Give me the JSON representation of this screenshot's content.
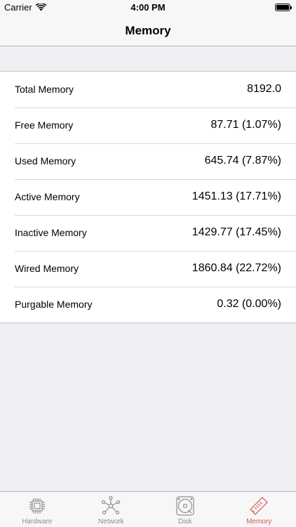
{
  "status_bar": {
    "carrier": "Carrier",
    "time": "4:00 PM"
  },
  "nav": {
    "title": "Memory"
  },
  "rows": [
    {
      "label": "Total Memory",
      "value": "8192.0"
    },
    {
      "label": "Free Memory",
      "value": "87.71 (1.07%)"
    },
    {
      "label": "Used Memory",
      "value": "645.74 (7.87%)"
    },
    {
      "label": "Active Memory",
      "value": "1451.13 (17.71%)"
    },
    {
      "label": "Inactive Memory",
      "value": "1429.77 (17.45%)"
    },
    {
      "label": "Wired Memory",
      "value": "1860.84 (22.72%)"
    },
    {
      "label": "Purgable Memory",
      "value": "0.32 (0.00%)"
    }
  ],
  "tabs": [
    {
      "label": "Hardware",
      "icon": "cpu-chip-icon",
      "active": false
    },
    {
      "label": "Network",
      "icon": "network-nodes-icon",
      "active": false
    },
    {
      "label": "Disk",
      "icon": "disk-icon",
      "active": false
    },
    {
      "label": "Memory",
      "icon": "memory-stick-icon",
      "active": true
    }
  ],
  "colors": {
    "tab_active": "#d3564f",
    "tab_inactive": "#8e8e93",
    "background": "#efeff4"
  }
}
